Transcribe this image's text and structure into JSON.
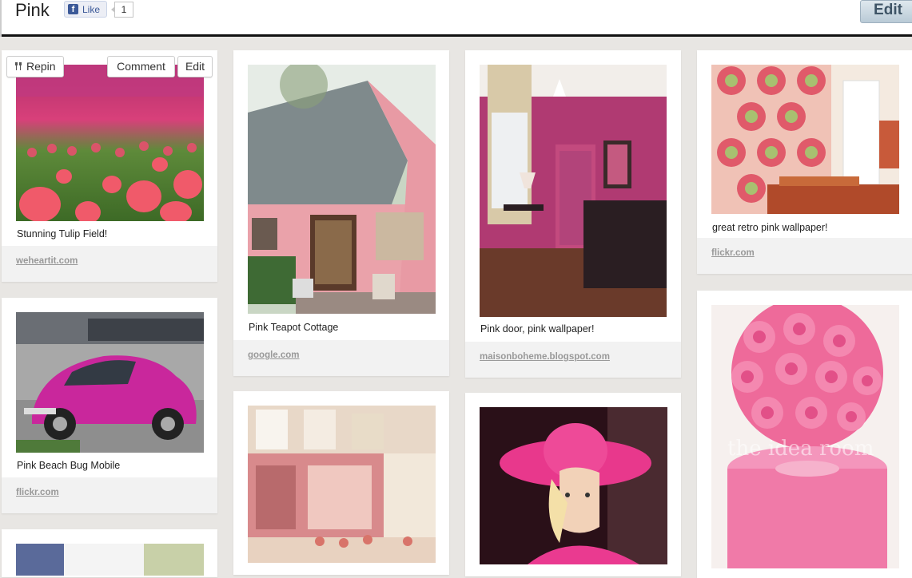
{
  "header": {
    "title": "Pink",
    "like_label": "Like",
    "like_count": "1",
    "edit_label": "Edit"
  },
  "pin_actions": {
    "repin": "Repin",
    "comment": "Comment",
    "edit": "Edit"
  },
  "pins": [
    {
      "desc": "Stunning Tulip Field!",
      "source": "weheartit.com",
      "icon": "tulip-field-photo"
    },
    {
      "desc": "Pink Beach Bug Mobile",
      "source": "flickr.com",
      "icon": "pink-beetle-car-photo"
    },
    {
      "desc": "Pink Teapot Cottage",
      "source": "google.com",
      "icon": "pink-cottage-photo"
    },
    {
      "desc": "",
      "source": "",
      "icon": "pink-street-cafe-photo"
    },
    {
      "desc": "Pink door, pink wallpaper!",
      "source": "maisonboheme.blogspot.com",
      "icon": "pink-room-photo"
    },
    {
      "desc": "",
      "source": "",
      "icon": "pink-hat-woman-photo"
    },
    {
      "desc": "great retro pink wallpaper!",
      "source": "flickr.com",
      "icon": "retro-wallpaper-photo"
    },
    {
      "desc": "",
      "source": "",
      "icon": "crepe-paper-roses-photo"
    }
  ],
  "watermark": "the idea room",
  "colors": {
    "accent": "#e8448a",
    "fb_blue": "#3b5998"
  }
}
